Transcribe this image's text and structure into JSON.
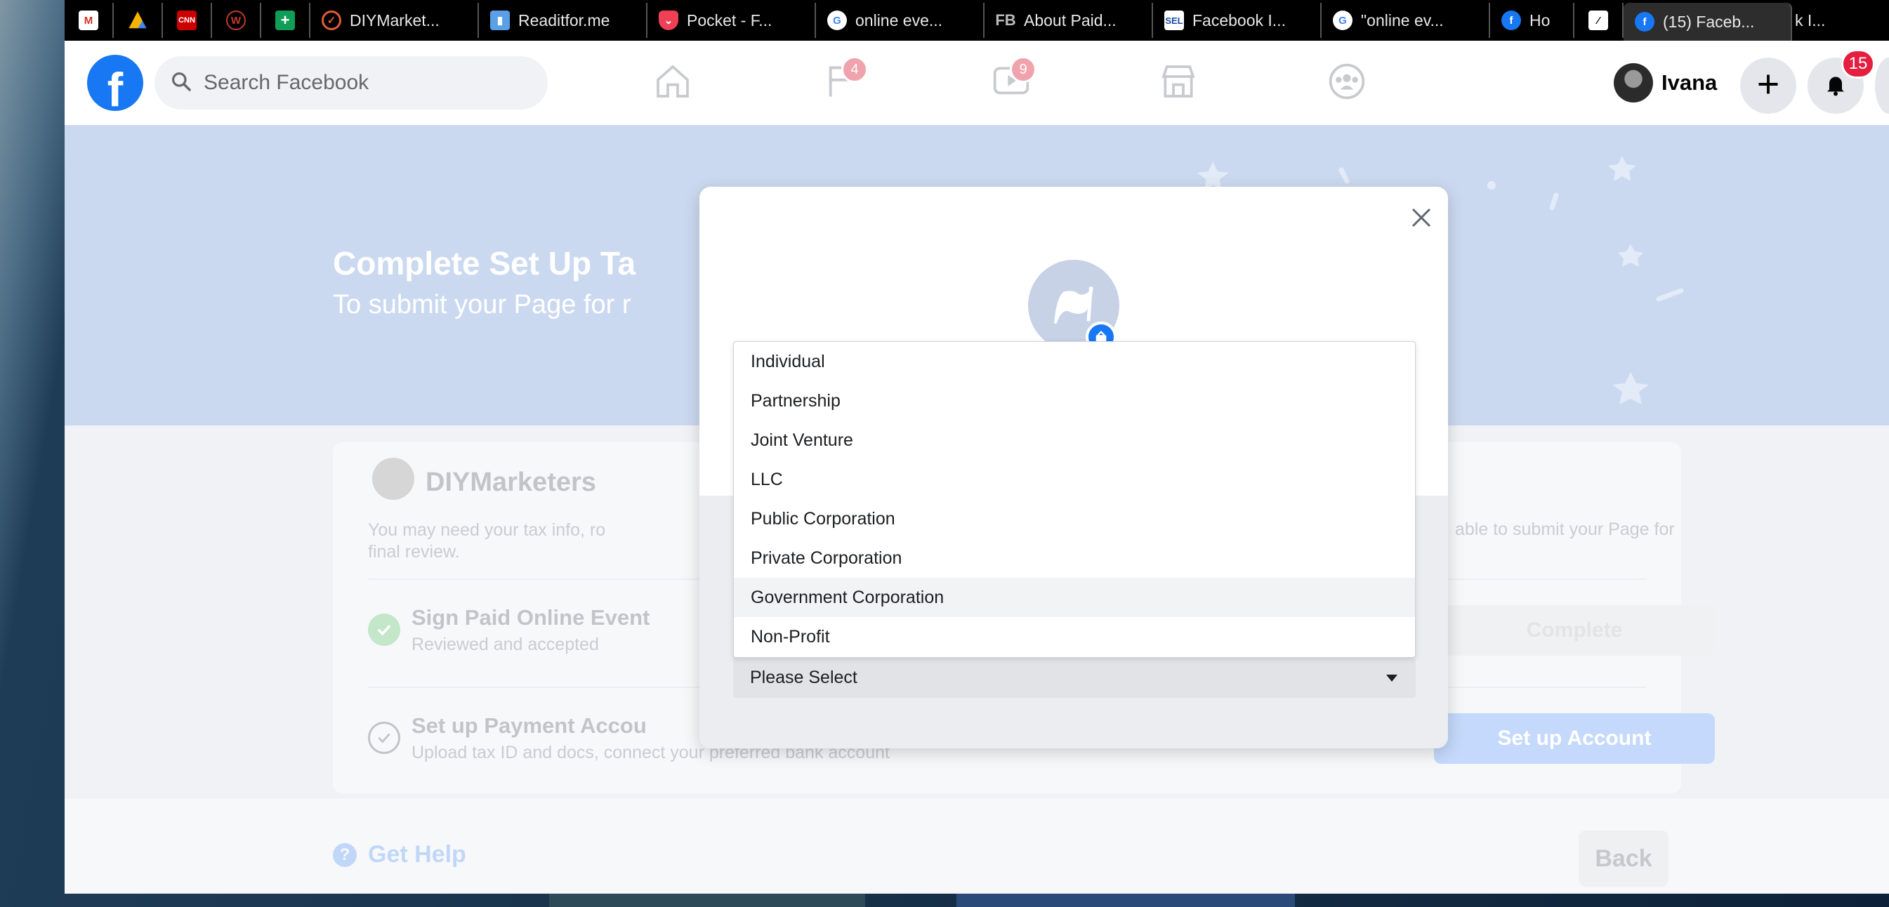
{
  "tabs": [
    {
      "icon": "gmail-icon",
      "title": ""
    },
    {
      "icon": "google-drive-icon",
      "title": ""
    },
    {
      "icon": "cnn-icon",
      "title": ""
    },
    {
      "icon": "w-icon",
      "title": ""
    },
    {
      "icon": "sheets-icon",
      "title": ""
    },
    {
      "icon": "check-icon",
      "title": "DIYMarket..."
    },
    {
      "icon": "book-icon",
      "title": "Readitfor.me"
    },
    {
      "icon": "pocket-icon",
      "title": "Pocket - F..."
    },
    {
      "icon": "google-icon",
      "title": "online eve..."
    },
    {
      "icon": "fb-text-icon",
      "title": "About Paid..."
    },
    {
      "icon": "sel-icon",
      "title": "Facebook I..."
    },
    {
      "icon": "google-icon",
      "title": "\"online ev..."
    },
    {
      "icon": "facebook-icon",
      "title": "Ho"
    },
    {
      "icon": "v-icon",
      "title": ""
    },
    {
      "icon": "facebook-icon",
      "title": "(15) Faceb..."
    },
    {
      "icon": "",
      "title": "k I..."
    }
  ],
  "header": {
    "search_placeholder": "Search Facebook",
    "pages_badge": "4",
    "watch_badge": "9",
    "user_name": "Ivana",
    "notifications_badge": "15",
    "logo": "f"
  },
  "banner": {
    "title": "Complete Set Up Ta",
    "subtitle": "To submit your Page for r"
  },
  "card": {
    "page_name": "DIYMarketers",
    "desc_line1": "You may need your tax info, ro",
    "desc_line2": "final review.",
    "right_note": "able to submit your Page for",
    "step1_title": "Sign Paid Online Event",
    "step1_sub": "Reviewed and accepted",
    "step1_button": "Complete",
    "step2_title": "Set up Payment Accou",
    "step2_sub": "Upload tax ID and docs, connect your preferred bank account",
    "step2_button": "Set up Account"
  },
  "footer": {
    "help": "Get Help",
    "help_icon": "?",
    "back": "Back"
  },
  "modal": {
    "select_value": "Please Select",
    "options": [
      "Individual",
      "Partnership",
      "Joint Venture",
      "LLC",
      "Public Corporation",
      "Private Corporation",
      "Government Corporation",
      "Non-Profit"
    ],
    "highlighted_option": "Government Corporation"
  },
  "colors": {
    "fb_blue": "#1877f2",
    "banner": "#cbd9f0",
    "badge_red": "#e41e3f"
  }
}
